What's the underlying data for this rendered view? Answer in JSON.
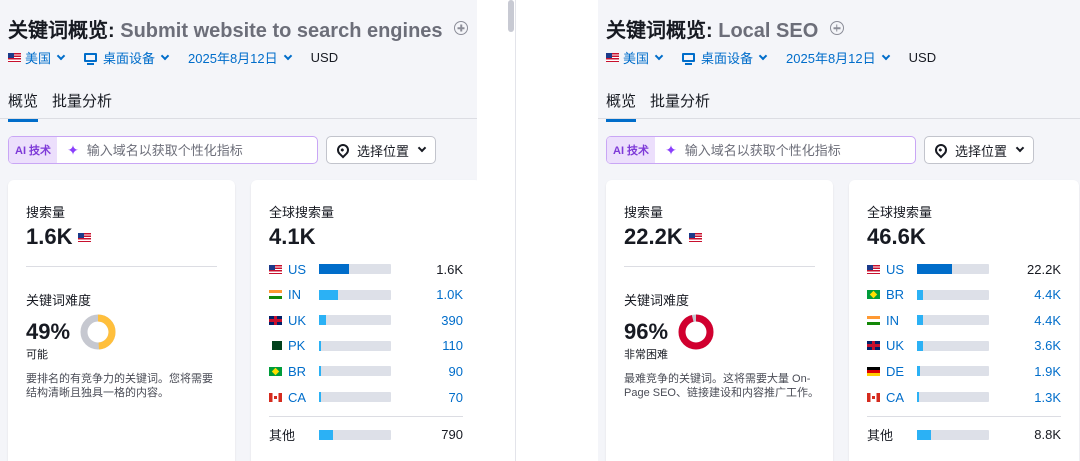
{
  "colors": {
    "bar_primary": "#006dca",
    "bar_secondary": "#2bb1f5",
    "donut_easy": "#ffbf3c",
    "donut_hard": "#d1002f",
    "donut_track": "#c6c8d0"
  },
  "panels": [
    {
      "title_prefix": "关键词概览:",
      "keyword": "Submit website to search engines",
      "filters": {
        "country": "美国",
        "device": "桌面设备",
        "date": "2025年8月12日",
        "currency": "USD"
      },
      "tabs": [
        "概览",
        "批量分析"
      ],
      "ai": {
        "badge": "AI 技术",
        "placeholder": "输入域名以获取个性化指标",
        "location_label": "选择位置"
      },
      "volume": {
        "label": "搜索量",
        "value": "1.6K"
      },
      "kd": {
        "label": "关键词难度",
        "percent_text": "49%",
        "percent": 49,
        "level": "可能",
        "desc": "要排名的有竞争力的关键词。您将需要结构清晰且独具一格的内容。",
        "color_key": "donut_easy"
      },
      "global": {
        "label": "全球搜索量",
        "value": "4.1K",
        "rows": [
          {
            "code": "US",
            "flag": "us",
            "share": 0.41,
            "value": "1.6K",
            "primary": true
          },
          {
            "code": "IN",
            "flag": "in",
            "share": 0.26,
            "value": "1.0K",
            "primary": false
          },
          {
            "code": "UK",
            "flag": "uk",
            "share": 0.1,
            "value": "390",
            "primary": false
          },
          {
            "code": "PK",
            "flag": "pk",
            "share": 0.03,
            "value": "110",
            "primary": false
          },
          {
            "code": "BR",
            "flag": "br",
            "share": 0.02,
            "value": "90",
            "primary": false
          },
          {
            "code": "CA",
            "flag": "ca",
            "share": 0.02,
            "value": "70",
            "primary": false
          }
        ],
        "other": {
          "label": "其他",
          "share": 0.19,
          "value": "790"
        }
      }
    },
    {
      "title_prefix": "关键词概览:",
      "keyword": "Local SEO",
      "filters": {
        "country": "美国",
        "device": "桌面设备",
        "date": "2025年8月12日",
        "currency": "USD"
      },
      "tabs": [
        "概览",
        "批量分析"
      ],
      "ai": {
        "badge": "AI 技术",
        "placeholder": "输入域名以获取个性化指标",
        "location_label": "选择位置"
      },
      "volume": {
        "label": "搜索量",
        "value": "22.2K"
      },
      "kd": {
        "label": "关键词难度",
        "percent_text": "96%",
        "percent": 96,
        "level": "非常困难",
        "desc": "最难竞争的关键词。这将需要大量 On-Page SEO、链接建设和内容推广工作。",
        "color_key": "donut_hard"
      },
      "global": {
        "label": "全球搜索量",
        "value": "46.6K",
        "rows": [
          {
            "code": "US",
            "flag": "us",
            "share": 0.48,
            "value": "22.2K",
            "primary": true
          },
          {
            "code": "BR",
            "flag": "br",
            "share": 0.09,
            "value": "4.4K",
            "primary": false
          },
          {
            "code": "IN",
            "flag": "in",
            "share": 0.09,
            "value": "4.4K",
            "primary": false
          },
          {
            "code": "UK",
            "flag": "uk",
            "share": 0.08,
            "value": "3.6K",
            "primary": false
          },
          {
            "code": "DE",
            "flag": "de",
            "share": 0.04,
            "value": "1.9K",
            "primary": false
          },
          {
            "code": "CA",
            "flag": "ca",
            "share": 0.03,
            "value": "1.3K",
            "primary": false
          }
        ],
        "other": {
          "label": "其他",
          "share": 0.19,
          "value": "8.8K"
        }
      }
    }
  ]
}
